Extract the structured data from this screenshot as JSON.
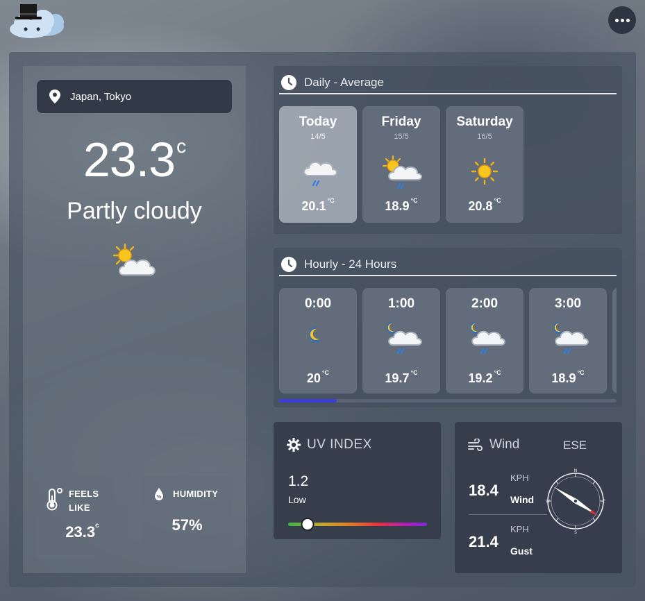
{
  "app": {
    "logo_icon": "top-hat-cloud-icon",
    "menu_icon": "more-horizontal-icon"
  },
  "location": {
    "icon": "map-pin-icon",
    "text": "Japan, Tokyo"
  },
  "current": {
    "temperature": "23.3",
    "unit": "c",
    "condition": "Partly cloudy",
    "icon": "partly-cloudy-icon"
  },
  "stats": {
    "feels_like": {
      "icon": "thermometer-icon",
      "label_line1": "FEELS",
      "label_line2": "LIKE",
      "value": "23.3",
      "unit": "c"
    },
    "humidity": {
      "icon": "humidity-drop-icon",
      "label": "HUMIDITY",
      "value": "57%"
    }
  },
  "daily": {
    "title": "Daily - Average",
    "days": [
      {
        "name": "Today",
        "date": "14/5",
        "temp": "20.1",
        "unit": "°C",
        "icon": "cloud-rain-icon"
      },
      {
        "name": "Friday",
        "date": "15/5",
        "temp": "18.9",
        "unit": "°C",
        "icon": "sun-cloud-rain-icon"
      },
      {
        "name": "Saturday",
        "date": "16/5",
        "temp": "20.8",
        "unit": "°C",
        "icon": "sun-icon"
      }
    ]
  },
  "hourly": {
    "title": "Hourly - 24 Hours",
    "hours": [
      {
        "time": "0:00",
        "temp": "20",
        "unit": "°C",
        "icon": "moon-icon"
      },
      {
        "time": "1:00",
        "temp": "19.7",
        "unit": "°C",
        "icon": "moon-cloud-rain-icon"
      },
      {
        "time": "2:00",
        "temp": "19.2",
        "unit": "°C",
        "icon": "moon-cloud-rain-icon"
      },
      {
        "time": "3:00",
        "temp": "18.9",
        "unit": "°C",
        "icon": "moon-cloud-rain-icon"
      }
    ],
    "scroll_position": 0.17
  },
  "uv": {
    "title": "UV INDEX",
    "value": "1.2",
    "level": "Low",
    "icon": "sun-gear-icon",
    "scale_position": 0.14
  },
  "wind": {
    "title": "Wind",
    "direction": "ESE",
    "icon": "wind-icon",
    "speed": {
      "value": "18.4",
      "unit": "KPH",
      "label": "Wind"
    },
    "gust": {
      "value": "21.4",
      "unit": "KPH",
      "label": "Gust"
    },
    "compass_icon": "compass-icon",
    "compass_letters": {
      "n": "N",
      "s": "S",
      "e": "E",
      "w": "W"
    }
  },
  "colors": {
    "scroll_thumb": "#3b3fd6",
    "compass_needle_tip": "#e0303a"
  }
}
